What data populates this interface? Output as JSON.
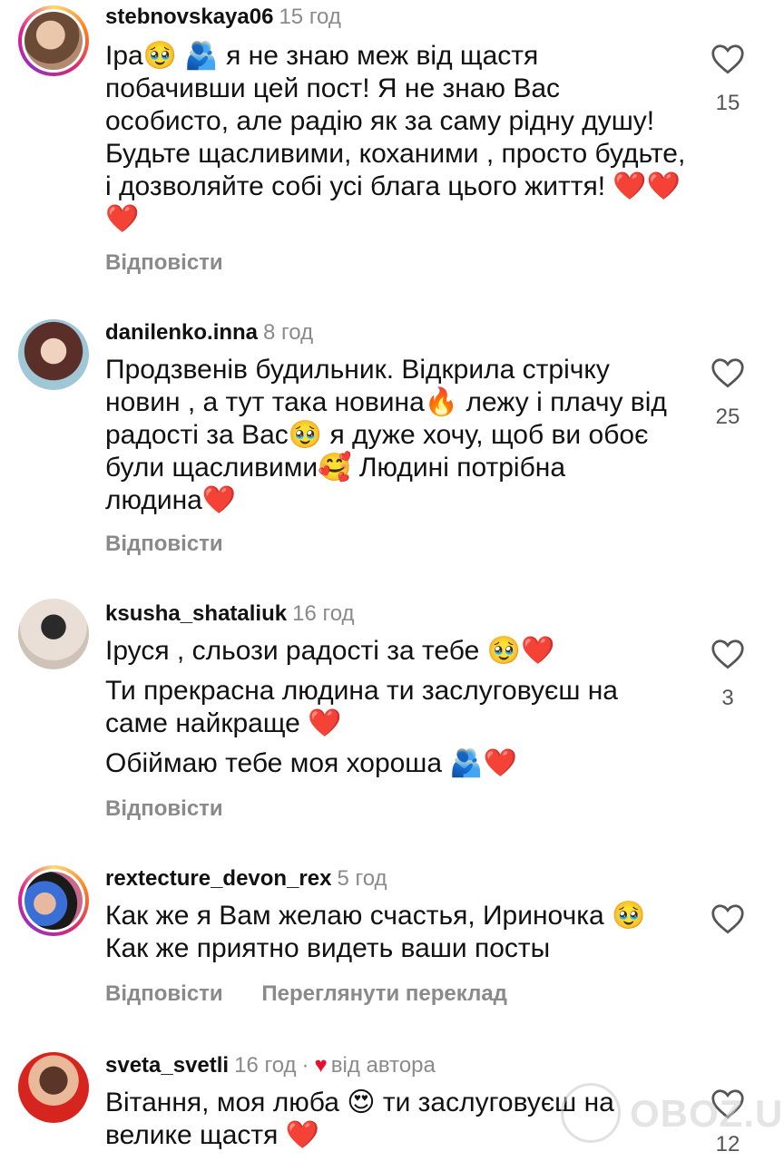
{
  "comments": [
    {
      "username": "stebnovskaya06",
      "time": "15 год",
      "lines": [
        "Іра🥹 🫂 я не знаю меж від щастя побачивши цей пост! Я не знаю Вас особисто, але радію як за саму рідну душу! Будьте щасливими, коханими , просто будьте, і дозволяйте собі усі блага цього життя! ❤️❤️❤️"
      ],
      "likes": "15",
      "reply": "Відповісти"
    },
    {
      "username": "danilenko.inna",
      "time": "8 год",
      "lines": [
        "Продзвенів будильник. Відкрила стрічку новин , а тут така новина🔥 лежу і плачу від радості за Вас🥹 я дуже хочу, щоб ви обоє були щасливими🥰 Людині потрібна людина❤️"
      ],
      "likes": "25",
      "reply": "Відповісти"
    },
    {
      "username": "ksusha_shataliuk",
      "time": "16 год",
      "lines": [
        "Іруся , сльози радості за тебе 🥹❤️",
        "Ти прекрасна людина ти заслуговуєш на саме найкраще ❤️",
        "Обіймаю тебе моя хороша 🫂❤️"
      ],
      "likes": "3",
      "reply": "Відповісти"
    },
    {
      "username": "rextecture_devon_rex",
      "time": "5 год",
      "lines": [
        "Как же я Вам желаю счастья, Ириночка 🥹 Как же приятно видеть ваши посты"
      ],
      "likes": "",
      "reply": "Відповісти",
      "translate": "Переглянути переклад"
    },
    {
      "username": "sveta_svetli",
      "time": "16 год",
      "author_like_label": "від автора",
      "lines": [
        "Вітання, моя люба 😍 ти заслуговуєш на велике щастя ❤️"
      ],
      "likes": "12",
      "reply": ""
    }
  ],
  "icons": {
    "like": "heart-outline-icon",
    "author_like": "heart-filled-icon"
  },
  "watermark": "OBOZ.UA",
  "colors": {
    "text": "#111111",
    "secondary": "#8a8a8a",
    "heart_red": "#e8112d"
  }
}
